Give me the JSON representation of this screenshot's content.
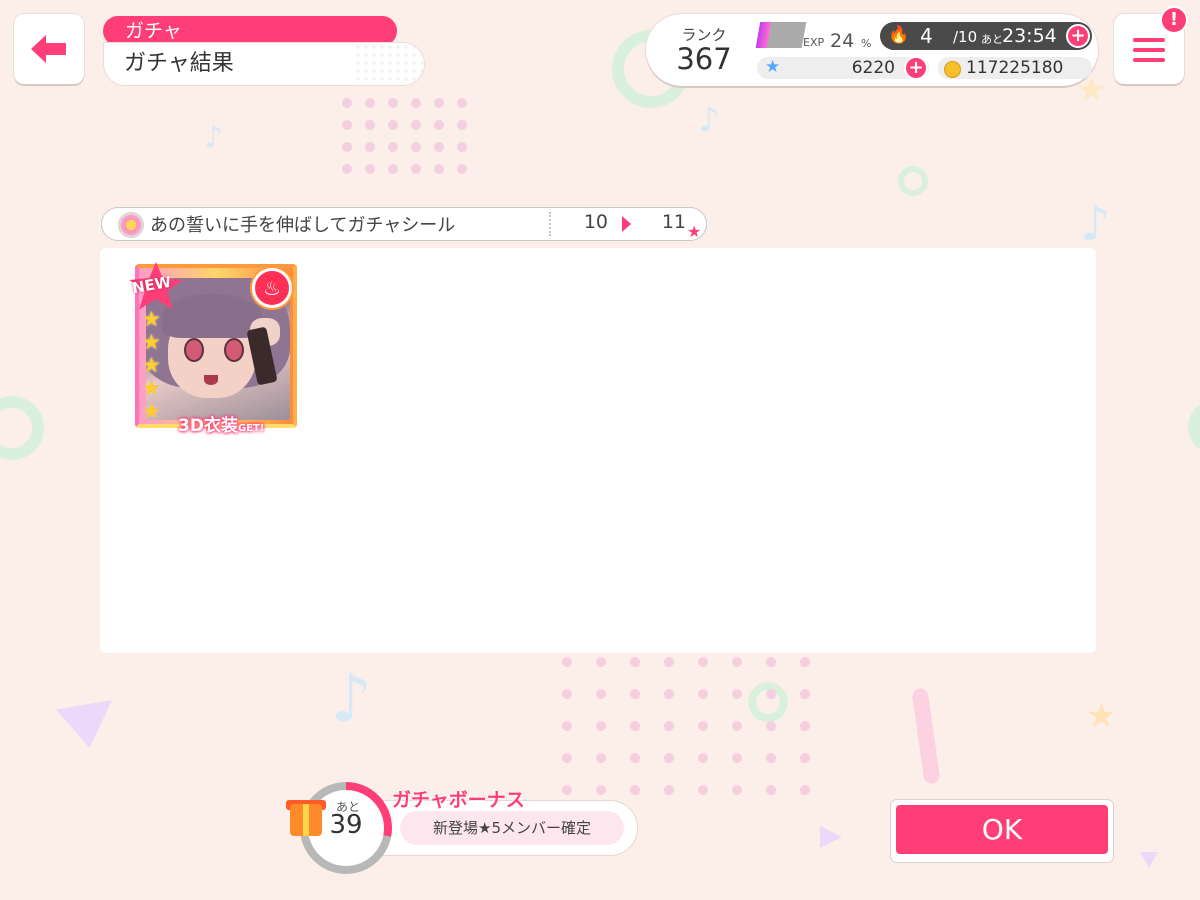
{
  "header": {
    "category": "ガチャ",
    "title": "ガチャ結果"
  },
  "status": {
    "rank_label": "ランク",
    "rank": "367",
    "exp_label": "EXP",
    "exp_percent": 24,
    "exp_value": "24",
    "exp_unit": "%",
    "live_count": "4",
    "live_max": "/10",
    "live_timer_prefix": "あと",
    "live_timer": "23:54",
    "gems": "6220",
    "coins": "117225180"
  },
  "item": {
    "name": "あの誓いに手を伸ばしてガチャシール",
    "before": "10",
    "after": "11"
  },
  "card": {
    "badge": "NEW",
    "rarity": 5,
    "costume_label": "3D衣装",
    "costume_suffix": "GET!"
  },
  "bonus": {
    "prefix": "あと",
    "count": "39",
    "title": "ガチャボーナス",
    "description": "新登場★5メンバー確定"
  },
  "actions": {
    "ok": "OK"
  },
  "icons": {
    "back": "arrow-left-icon",
    "menu": "hamburger-menu-icon",
    "notification": "exclamation-icon",
    "live": "flame-icon",
    "gem": "star-icon",
    "coin": "coin-icon"
  },
  "colors": {
    "accent": "#ff3d77",
    "background": "#fcefe9"
  }
}
